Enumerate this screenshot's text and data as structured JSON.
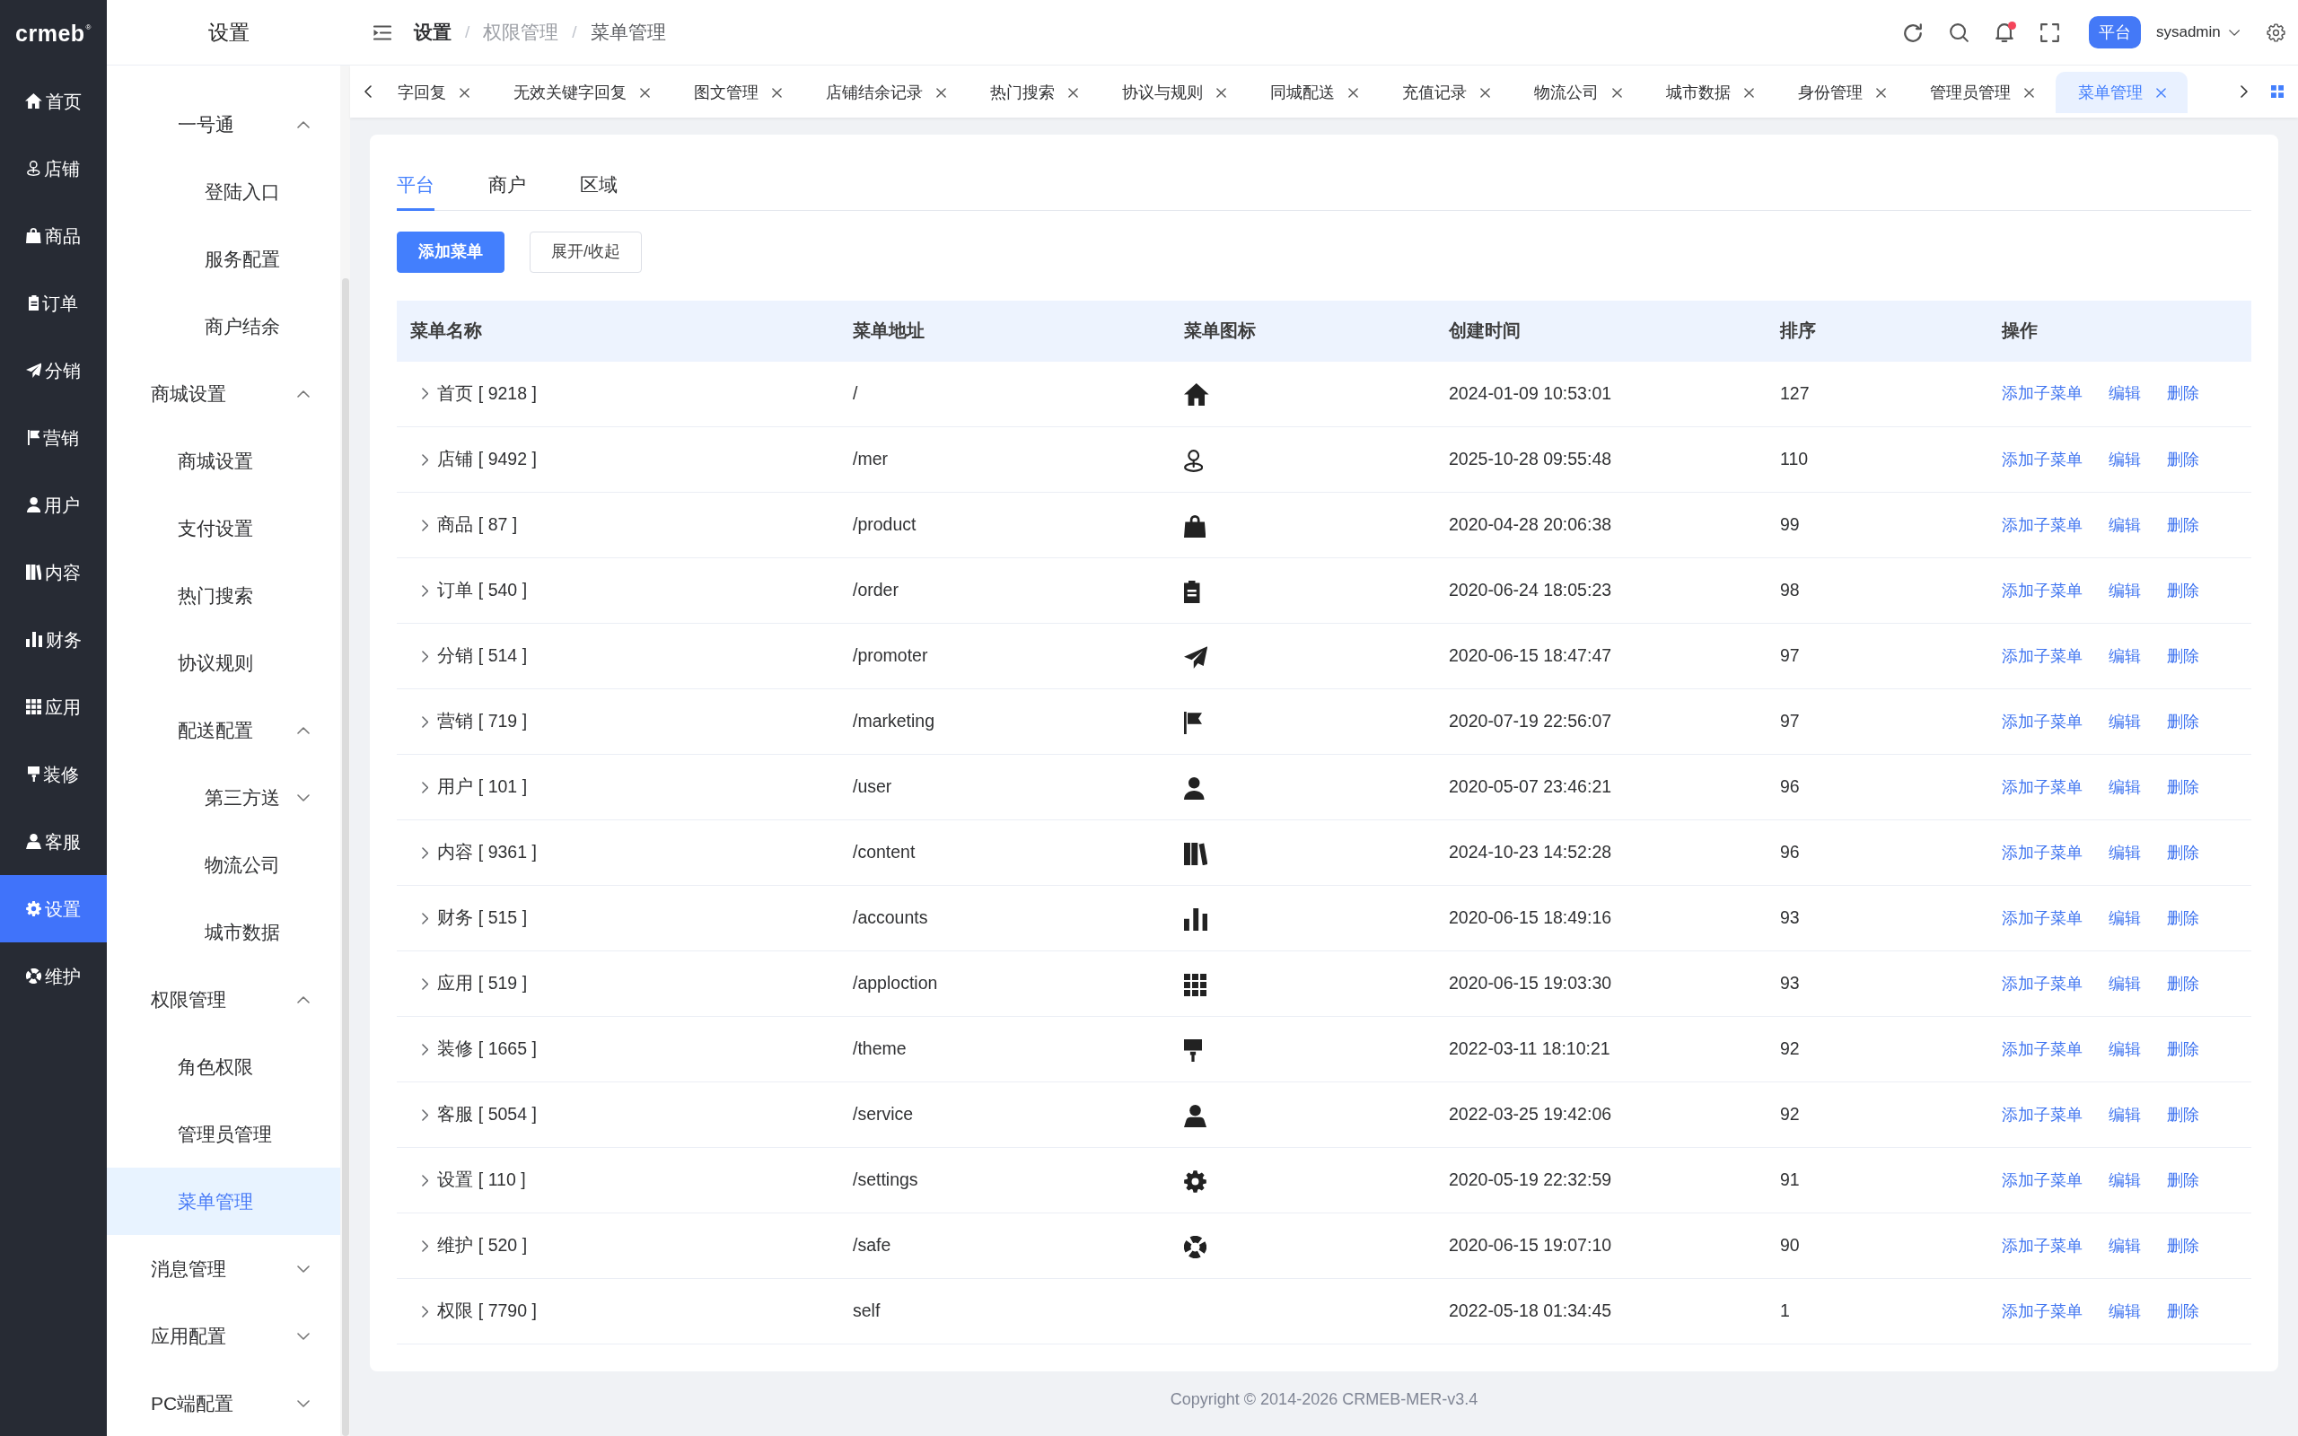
{
  "sidebar": {
    "logo": "crmeb$^{®}$",
    "items": [
      {
        "label": "首页",
        "selected": false
      },
      {
        "label": "店铺",
        "selected": false
      },
      {
        "label": "商品",
        "selected": false
      },
      {
        "label": "订单",
        "selected": false
      },
      {
        "label": "分销",
        "selected": false
      },
      {
        "label": "营销",
        "selected": false
      },
      {
        "label": "用户",
        "selected": false
      },
      {
        "label": "内容",
        "selected": false
      },
      {
        "label": "财务",
        "selected": false
      },
      {
        "label": "应用",
        "selected": false
      },
      {
        "label": "装修",
        "selected": false
      },
      {
        "label": "客服",
        "selected": false
      },
      {
        "label": "设置",
        "selected": true
      },
      {
        "label": "维护",
        "selected": false
      }
    ]
  },
  "submenu": {
    "title": "设置",
    "items": [
      {
        "children": [
          {
            "label": "一号通",
            "expanded": true,
            "children": [
              {
                "label": "登陆入口",
                "selected": false
              },
              {
                "label": "服务配置",
                "selected": false
              },
              {
                "label": "商户结余",
                "selected": false
              }
            ]
          }
        ]
      },
      {
        "label": "商城设置",
        "expanded": true,
        "children": [
          {
            "label": "商城设置",
            "selected": false
          },
          {
            "label": "支付设置",
            "selected": false
          },
          {
            "label": "热门搜索",
            "selected": false
          },
          {
            "label": "协议规则",
            "selected": false
          },
          {
            "label": "配送配置",
            "expanded": true,
            "children": [
              {
                "label": "第三方送",
                "expanded": false
              },
              {
                "label": "物流公司",
                "selected": false
              },
              {
                "label": "城市数据",
                "selected": false
              }
            ]
          }
        ]
      },
      {
        "label": "权限管理",
        "expanded": true,
        "children": [
          {
            "label": "角色权限",
            "selected": false
          },
          {
            "label": "管理员管理",
            "selected": false
          },
          {
            "label": "菜单管理",
            "selected": true
          }
        ]
      },
      {
        "label": "消息管理",
        "expanded": false
      },
      {
        "label": "应用配置",
        "expanded": false
      },
      {
        "label": "PC端配置",
        "expanded": false
      }
    ]
  },
  "header": {
    "breadcrumb": [
      {
        "label": "设置"
      },
      {
        "separator": "/",
        "label": "权限管理"
      },
      {
        "separator": "/",
        "label": "菜单管理"
      }
    ],
    "unread": true,
    "mode": "平台",
    "user": "sysadmin"
  },
  "page_tabs": [
    {
      "label": "字回复",
      "selected": false
    },
    {
      "label": "无效关键字回复",
      "selected": false
    },
    {
      "label": "图文管理",
      "selected": false
    },
    {
      "label": "店铺结余记录",
      "selected": false
    },
    {
      "label": "热门搜索",
      "selected": false
    },
    {
      "label": "协议与规则",
      "selected": false
    },
    {
      "label": "同城配送",
      "selected": false
    },
    {
      "label": "充值记录",
      "selected": false
    },
    {
      "label": "物流公司",
      "selected": false
    },
    {
      "label": "城市数据",
      "selected": false
    },
    {
      "label": "身份管理",
      "selected": false
    },
    {
      "label": "管理员管理",
      "selected": false
    },
    {
      "label": "菜单管理",
      "selected": true
    }
  ],
  "card": {
    "tabs": [
      {
        "label": "平台",
        "selected": true
      },
      {
        "label": "商户",
        "selected": false
      },
      {
        "label": "区域",
        "selected": false
      }
    ],
    "buttons": [
      {
        "label": "添加菜单",
        "kind": "primary"
      },
      {
        "label": "展开/收起",
        "kind": "outline"
      }
    ],
    "table": {
      "columns": [
        "菜单名称",
        "菜单地址",
        "菜单图标",
        "创建时间",
        "排序",
        "操作"
      ],
      "rows": [
        {
          "name": "首页 [ 9218 ]",
          "expanded": false,
          "path": "/",
          "created": "2024-01-09 10:53:01",
          "sort": "127",
          "actions": [
            "添加子菜单",
            "编辑",
            "删除"
          ]
        },
        {
          "name": "店铺 [ 9492 ]",
          "expanded": false,
          "path": "/mer",
          "created": "2025-10-28 09:55:48",
          "sort": "110",
          "actions": [
            "添加子菜单",
            "编辑",
            "删除"
          ]
        },
        {
          "name": "商品 [ 87 ]",
          "expanded": false,
          "path": "/product",
          "created": "2020-04-28 20:06:38",
          "sort": "99",
          "actions": [
            "添加子菜单",
            "编辑",
            "删除"
          ]
        },
        {
          "name": "订单 [ 540 ]",
          "expanded": false,
          "path": "/order",
          "created": "2020-06-24 18:05:23",
          "sort": "98",
          "actions": [
            "添加子菜单",
            "编辑",
            "删除"
          ]
        },
        {
          "name": "分销 [ 514 ]",
          "expanded": false,
          "path": "/promoter",
          "created": "2020-06-15 18:47:47",
          "sort": "97",
          "actions": [
            "添加子菜单",
            "编辑",
            "删除"
          ]
        },
        {
          "name": "营销 [ 719 ]",
          "expanded": false,
          "path": "/marketing",
          "created": "2020-07-19 22:56:07",
          "sort": "97",
          "actions": [
            "添加子菜单",
            "编辑",
            "删除"
          ]
        },
        {
          "name": "用户 [ 101 ]",
          "expanded": false,
          "path": "/user",
          "created": "2020-05-07 23:46:21",
          "sort": "96",
          "actions": [
            "添加子菜单",
            "编辑",
            "删除"
          ]
        },
        {
          "name": "内容 [ 9361 ]",
          "expanded": false,
          "path": "/content",
          "created": "2024-10-23 14:52:28",
          "sort": "96",
          "actions": [
            "添加子菜单",
            "编辑",
            "删除"
          ]
        },
        {
          "name": "财务 [ 515 ]",
          "expanded": false,
          "path": "/accounts",
          "created": "2020-06-15 18:49:16",
          "sort": "93",
          "actions": [
            "添加子菜单",
            "编辑",
            "删除"
          ]
        },
        {
          "name": "应用 [ 519 ]",
          "expanded": false,
          "path": "/apploction",
          "created": "2020-06-15 19:03:30",
          "sort": "93",
          "actions": [
            "添加子菜单",
            "编辑",
            "删除"
          ]
        },
        {
          "name": "装修 [ 1665 ]",
          "expanded": false,
          "path": "/theme",
          "created": "2022-03-11 18:10:21",
          "sort": "92",
          "actions": [
            "添加子菜单",
            "编辑",
            "删除"
          ]
        },
        {
          "name": "客服 [ 5054 ]",
          "expanded": false,
          "path": "/service",
          "created": "2022-03-25 19:42:06",
          "sort": "92",
          "actions": [
            "添加子菜单",
            "编辑",
            "删除"
          ]
        },
        {
          "name": "设置 [ 110 ]",
          "expanded": false,
          "path": "/settings",
          "created": "2020-05-19 22:32:59",
          "sort": "91",
          "actions": [
            "添加子菜单",
            "编辑",
            "删除"
          ]
        },
        {
          "name": "维护 [ 520 ]",
          "expanded": false,
          "path": "/safe",
          "created": "2020-06-15 19:07:10",
          "sort": "90",
          "actions": [
            "添加子菜单",
            "编辑",
            "删除"
          ]
        },
        {
          "name": "权限 [ 7790 ]",
          "expanded": false,
          "path": "self",
          "created": "2022-05-18 01:34:45",
          "sort": "1",
          "actions": [
            "添加子菜单",
            "编辑",
            "删除"
          ]
        }
      ]
    }
  },
  "footer": {
    "text": "Copyright © 2014-2026 CRMEB-MER-v3.4"
  }
}
